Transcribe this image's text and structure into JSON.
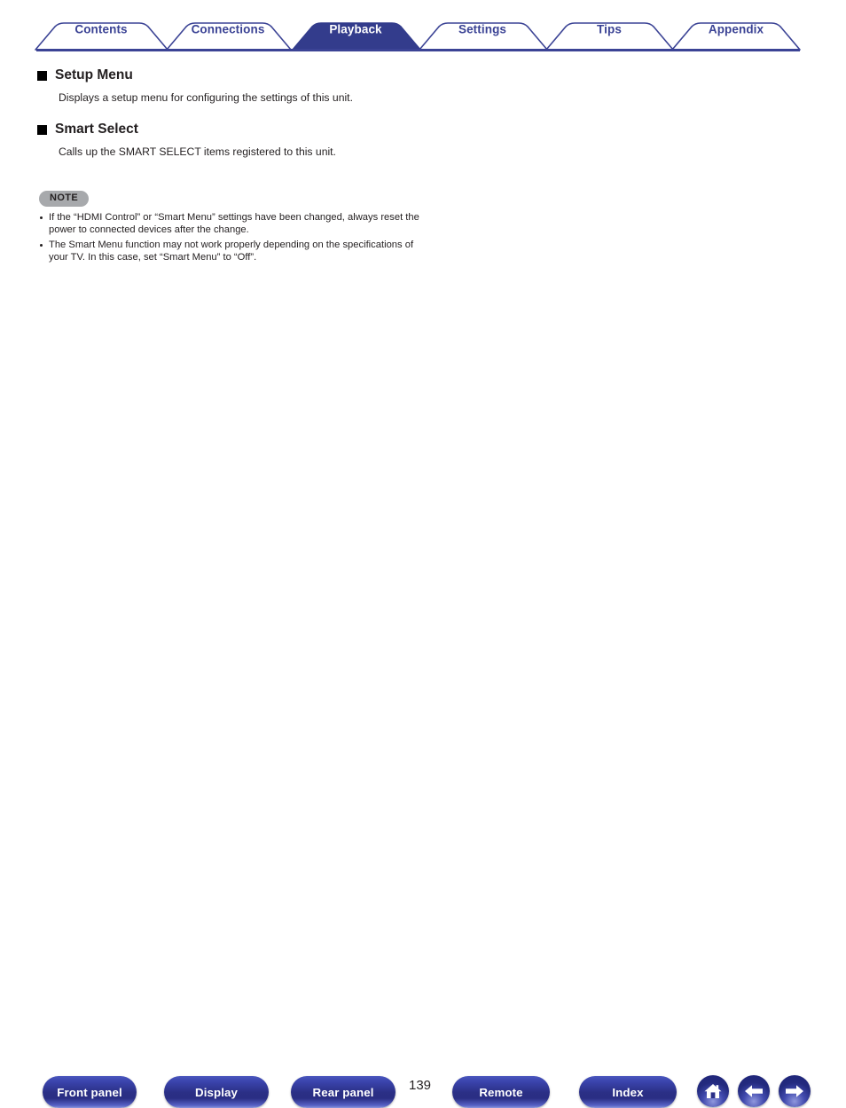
{
  "tabs": [
    {
      "label": "Contents",
      "active": false
    },
    {
      "label": "Connections",
      "active": false
    },
    {
      "label": "Playback",
      "active": true
    },
    {
      "label": "Settings",
      "active": false
    },
    {
      "label": "Tips",
      "active": false
    },
    {
      "label": "Appendix",
      "active": false
    }
  ],
  "sections": [
    {
      "heading": "Setup Menu",
      "description": "Displays a setup menu for configuring the settings of this unit."
    },
    {
      "heading": "Smart Select",
      "description": "Calls up the SMART SELECT items registered to this unit."
    }
  ],
  "note": {
    "badge": "NOTE",
    "items": [
      "If the “HDMI Control” or “Smart Menu” settings have been changed, always reset the power to connected devices after the change.",
      "The Smart Menu function may not work properly depending on the specifications of your TV. In this case, set “Smart Menu” to “Off”."
    ]
  },
  "footer": {
    "buttons": [
      {
        "label": "Front panel"
      },
      {
        "label": "Display"
      },
      {
        "label": "Rear panel"
      },
      {
        "label": "Remote"
      },
      {
        "label": "Index"
      }
    ],
    "page_number": "139",
    "icons": [
      {
        "name": "home-icon"
      },
      {
        "name": "arrow-left-icon"
      },
      {
        "name": "arrow-right-icon"
      }
    ]
  },
  "colors": {
    "brand_blue": "#3b4395",
    "active_tab": "#333c8c",
    "note_gray": "#a7a9ac",
    "text": "#231f20"
  }
}
